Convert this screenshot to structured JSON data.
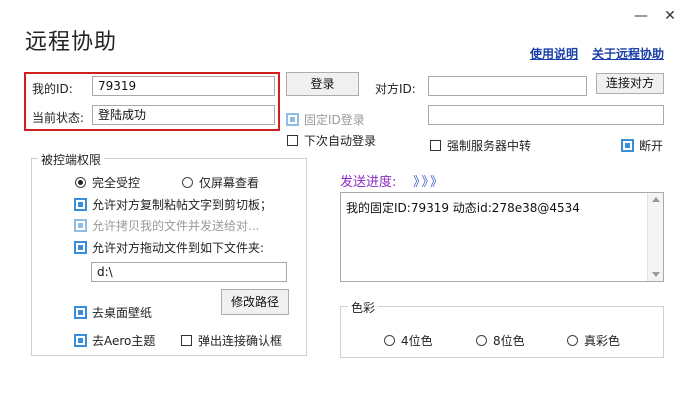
{
  "window": {
    "title": "远程协助",
    "minimize_glyph": "—",
    "close_glyph": "✕"
  },
  "links": {
    "help": "使用说明",
    "about": "关于远程协助"
  },
  "identity": {
    "my_id_label": "我的ID:",
    "my_id_value": "79319",
    "status_label": "当前状态:",
    "status_value": "登陆成功",
    "login_button": "登录",
    "fixed_id_login": "固定ID登录",
    "auto_login_next": "下次自动登录"
  },
  "peer": {
    "peer_id_label": "对方ID:",
    "peer_id_value": "",
    "connect_button": "连接对方",
    "second_field_value": "",
    "force_relay": "强制服务器中转",
    "disconnect": "断开"
  },
  "permissions": {
    "group_title": "被控端权限",
    "full_control": "完全受控",
    "view_only": "仅屏幕查看",
    "allow_clipboard": "允许对方复制粘帖文字到剪切板；",
    "allow_copy_files": "允许拷贝我的文件并发送给对...",
    "allow_drag_files": "允许对方拖动文件到如下文件夹:",
    "folder_path": "d:\\",
    "remove_wallpaper": "去桌面壁纸",
    "modify_path_button": "修改路径",
    "remove_aero": "去Aero主题",
    "popup_confirm": "弹出连接确认框"
  },
  "send": {
    "progress_label": "发送进度:",
    "progress_arrows": "》》》",
    "log_text": "我的固定ID:79319 动态id:278e38@4534"
  },
  "color": {
    "group_title": "色彩",
    "opt_4bit": "4位色",
    "opt_8bit": "8位色",
    "opt_true": "真彩色"
  },
  "icons": {
    "checked": "checkbox-checked-icon",
    "unchecked": "checkbox-unchecked-icon",
    "radio_on": "radio-selected-icon",
    "radio_off": "radio-unselected-icon"
  },
  "colors": {
    "accent": "#3a8ed8",
    "highlight_border": "#d01f1f",
    "link": "#1a3faa",
    "progress_label": "#8b2cc8",
    "arrows": "#3a5fd0"
  }
}
